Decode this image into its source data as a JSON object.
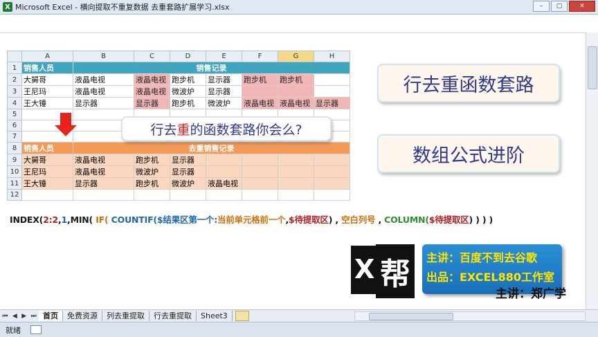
{
  "window": {
    "title": "Microsoft Excel - 横向提取不重复数据 去重套路扩展学习.xlsx",
    "app_icon": "X",
    "minimize": "–",
    "restore": "▢",
    "close": "✕"
  },
  "columns": [
    "A",
    "B",
    "C",
    "D",
    "E",
    "F",
    "G",
    "H"
  ],
  "selected_column": "G",
  "rows": {
    "r1": {
      "num": "1",
      "a": "销售人员",
      "merged": "销售记录"
    },
    "r2": {
      "num": "2",
      "a": "大舅哥",
      "b": "液晶电视",
      "c": "液晶电视",
      "d": "跑步机",
      "e": "显示器",
      "f": "跑步机",
      "g": "跑步机",
      "h": ""
    },
    "r3": {
      "num": "3",
      "a": "王尼玛",
      "b": "液晶电视",
      "c": "液晶电视",
      "d": "微波炉",
      "e": "显示器",
      "f": "",
      "g": "",
      "h": ""
    },
    "r4": {
      "num": "4",
      "a": "王大锤",
      "b": "显示器",
      "c": "显示器",
      "d": "跑步机",
      "e": "微波炉",
      "f": "液晶电视",
      "g": "液晶电视",
      "h": "显示器"
    },
    "r5": {
      "num": "5"
    },
    "r6": {
      "num": "6"
    },
    "r7": {
      "num": "7"
    },
    "r8": {
      "num": "8",
      "a": "销售人员",
      "merged": "去重销售记录"
    },
    "r9": {
      "num": "9",
      "a": "大舅哥",
      "b": "液晶电视",
      "c": "跑步机",
      "d": "显示器",
      "e": ""
    },
    "r10": {
      "num": "10",
      "a": "王尼玛",
      "b": "液晶电视",
      "c": "微波炉",
      "d": "显示器",
      "e": ""
    },
    "r11": {
      "num": "11",
      "a": "王大锤",
      "b": "显示器",
      "c": "跑步机",
      "d": "微波炉",
      "e": "液晶电视"
    },
    "r12": {
      "num": "12"
    }
  },
  "callouts": {
    "question_pre": "行去",
    "question_red": "重",
    "question_post": "的函数套路你会么?",
    "main1": "行去重函数套路",
    "main2": "数组公式进阶"
  },
  "formula": {
    "p1": "INDEX(",
    "p2": "2:2",
    "p3": ",",
    "p4": "1",
    "p5": ",MIN( ",
    "p6": "IF(",
    "p7": " COUNTIF(",
    "p8": "$结果区第一个:",
    "p9": "当前单元格前一个",
    "p10": ",",
    "p11": "$待提取区",
    "p12": ") , ",
    "p13": "空白列号",
    "p14": " , ",
    "p15": "COLUMN(",
    "p16": "$待提取区",
    "p17": ") ) ) )"
  },
  "logo": {
    "x": "X",
    "char": "帮"
  },
  "promo": {
    "line1": "主讲：百度不到去谷歌",
    "line2": "出品：EXCEL880工作室"
  },
  "lecturer": "主讲：郑广学",
  "tabs": [
    "首页",
    "免费资源",
    "列去重提取",
    "行去重提取",
    "Sheet3"
  ],
  "active_tab": "首页",
  "status": {
    "text": "就绪"
  }
}
